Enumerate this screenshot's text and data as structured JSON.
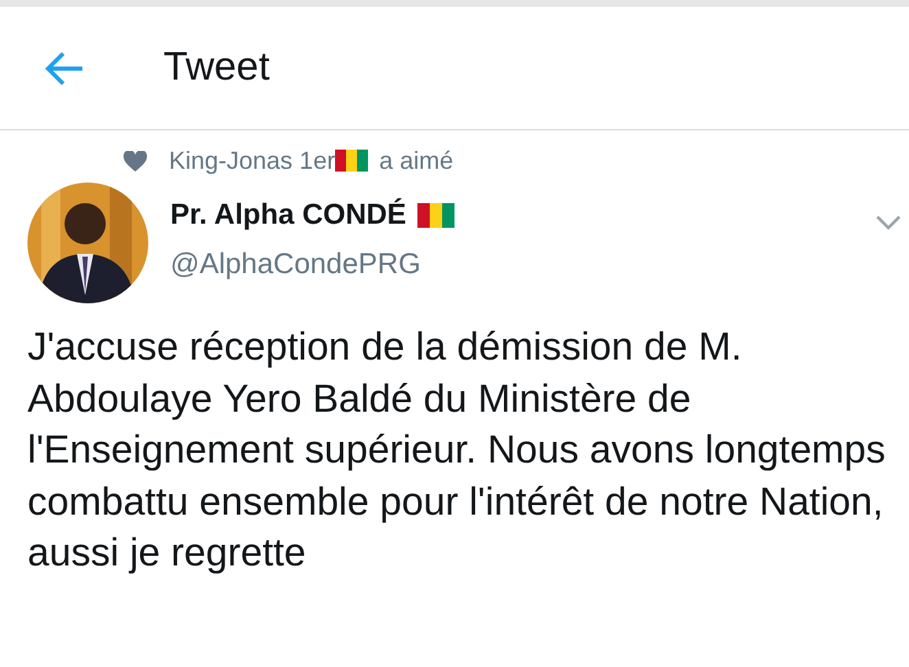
{
  "header": {
    "title": "Tweet"
  },
  "social_context": {
    "user": "King-Jonas 1er",
    "action": "a aimé"
  },
  "tweet": {
    "author": {
      "name": "Pr. Alpha CONDÉ",
      "handle": "@AlphaCondePRG"
    },
    "text": "J'accuse réception de la démission de M. Abdoulaye Yero Baldé du Ministère de l'Enseignement supérieur. Nous avons longtemps combattu ensemble pour l'intérêt de notre Nation, aussi je regrette"
  }
}
